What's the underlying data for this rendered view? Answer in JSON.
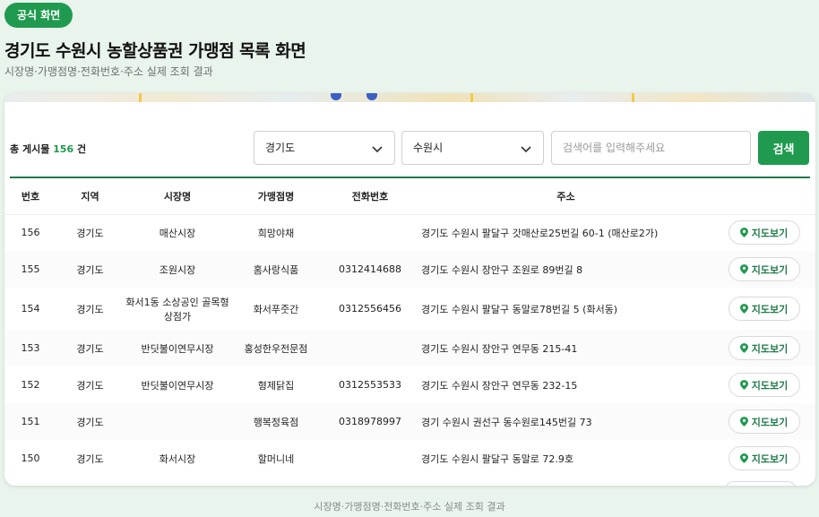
{
  "header": {
    "badge": "공식 화면",
    "title": "경기도 수원시 농할상품권 가맹점 목록 화면",
    "subtitle": "시장명·가맹점명·전화번호·주소 실제 조회 결과"
  },
  "toolbar": {
    "count_prefix": "총 게시물",
    "count_value": "156",
    "count_suffix": "건",
    "province_select": "경기도",
    "city_select": "수원시",
    "search_placeholder": "검색어를 입력해주세요",
    "search_value": "",
    "search_button": "검색"
  },
  "table": {
    "columns": [
      "번호",
      "지역",
      "시장명",
      "가맹점명",
      "전화번호",
      "주소",
      ""
    ],
    "rows": [
      {
        "no": "156",
        "region": "경기도",
        "market": "매산시장",
        "store": "희망야채",
        "phone": "",
        "address": "경기도 수원시 팔달구 갓매산로25번길 60-1 (매산로2가)",
        "action": "지도보기"
      },
      {
        "no": "155",
        "region": "경기도",
        "market": "조원시장",
        "store": "홈사랑식품",
        "phone": "0312414688",
        "address": "경기도 수원시 장안구 조원로 89번길 8",
        "action": "지도보기"
      },
      {
        "no": "154",
        "region": "경기도",
        "market": "화서1동 소상공인 골목형상점가",
        "store": "화서푸줏간",
        "phone": "0312556456",
        "address": "경기도 수원시 팔달구 동말로78번길 5 (화서동)",
        "action": "지도보기"
      },
      {
        "no": "153",
        "region": "경기도",
        "market": "반딧불이연무시장",
        "store": "홍성한우전문점",
        "phone": "",
        "address": "경기도 수원시 장안구 연무동 215-41",
        "action": "지도보기"
      },
      {
        "no": "152",
        "region": "경기도",
        "market": "반딧불이연무시장",
        "store": "형제닭집",
        "phone": "0312553533",
        "address": "경기도 수원시 장안구 연무동 232-15",
        "action": "지도보기"
      },
      {
        "no": "151",
        "region": "경기도",
        "market": "",
        "store": "행복정육점",
        "phone": "0318978997",
        "address": "경기 수원시 권선구 동수원로145번길 73",
        "action": "지도보기"
      },
      {
        "no": "150",
        "region": "경기도",
        "market": "화서시장",
        "store": "할머니네",
        "phone": "",
        "address": "경기도 수원시 팔달구 동말로 72.9호",
        "action": "지도보기"
      }
    ]
  },
  "footer": {
    "note": "시장명·가맹점명·전화번호·주소 실제 조회 결과"
  },
  "colors": {
    "accent": "#1f9a4f",
    "background": "#e9f4ec",
    "divider": "#1f7a4a"
  },
  "icons": {
    "select_arrow": "chevron-down-icon",
    "map_button": "map-pin-icon"
  }
}
